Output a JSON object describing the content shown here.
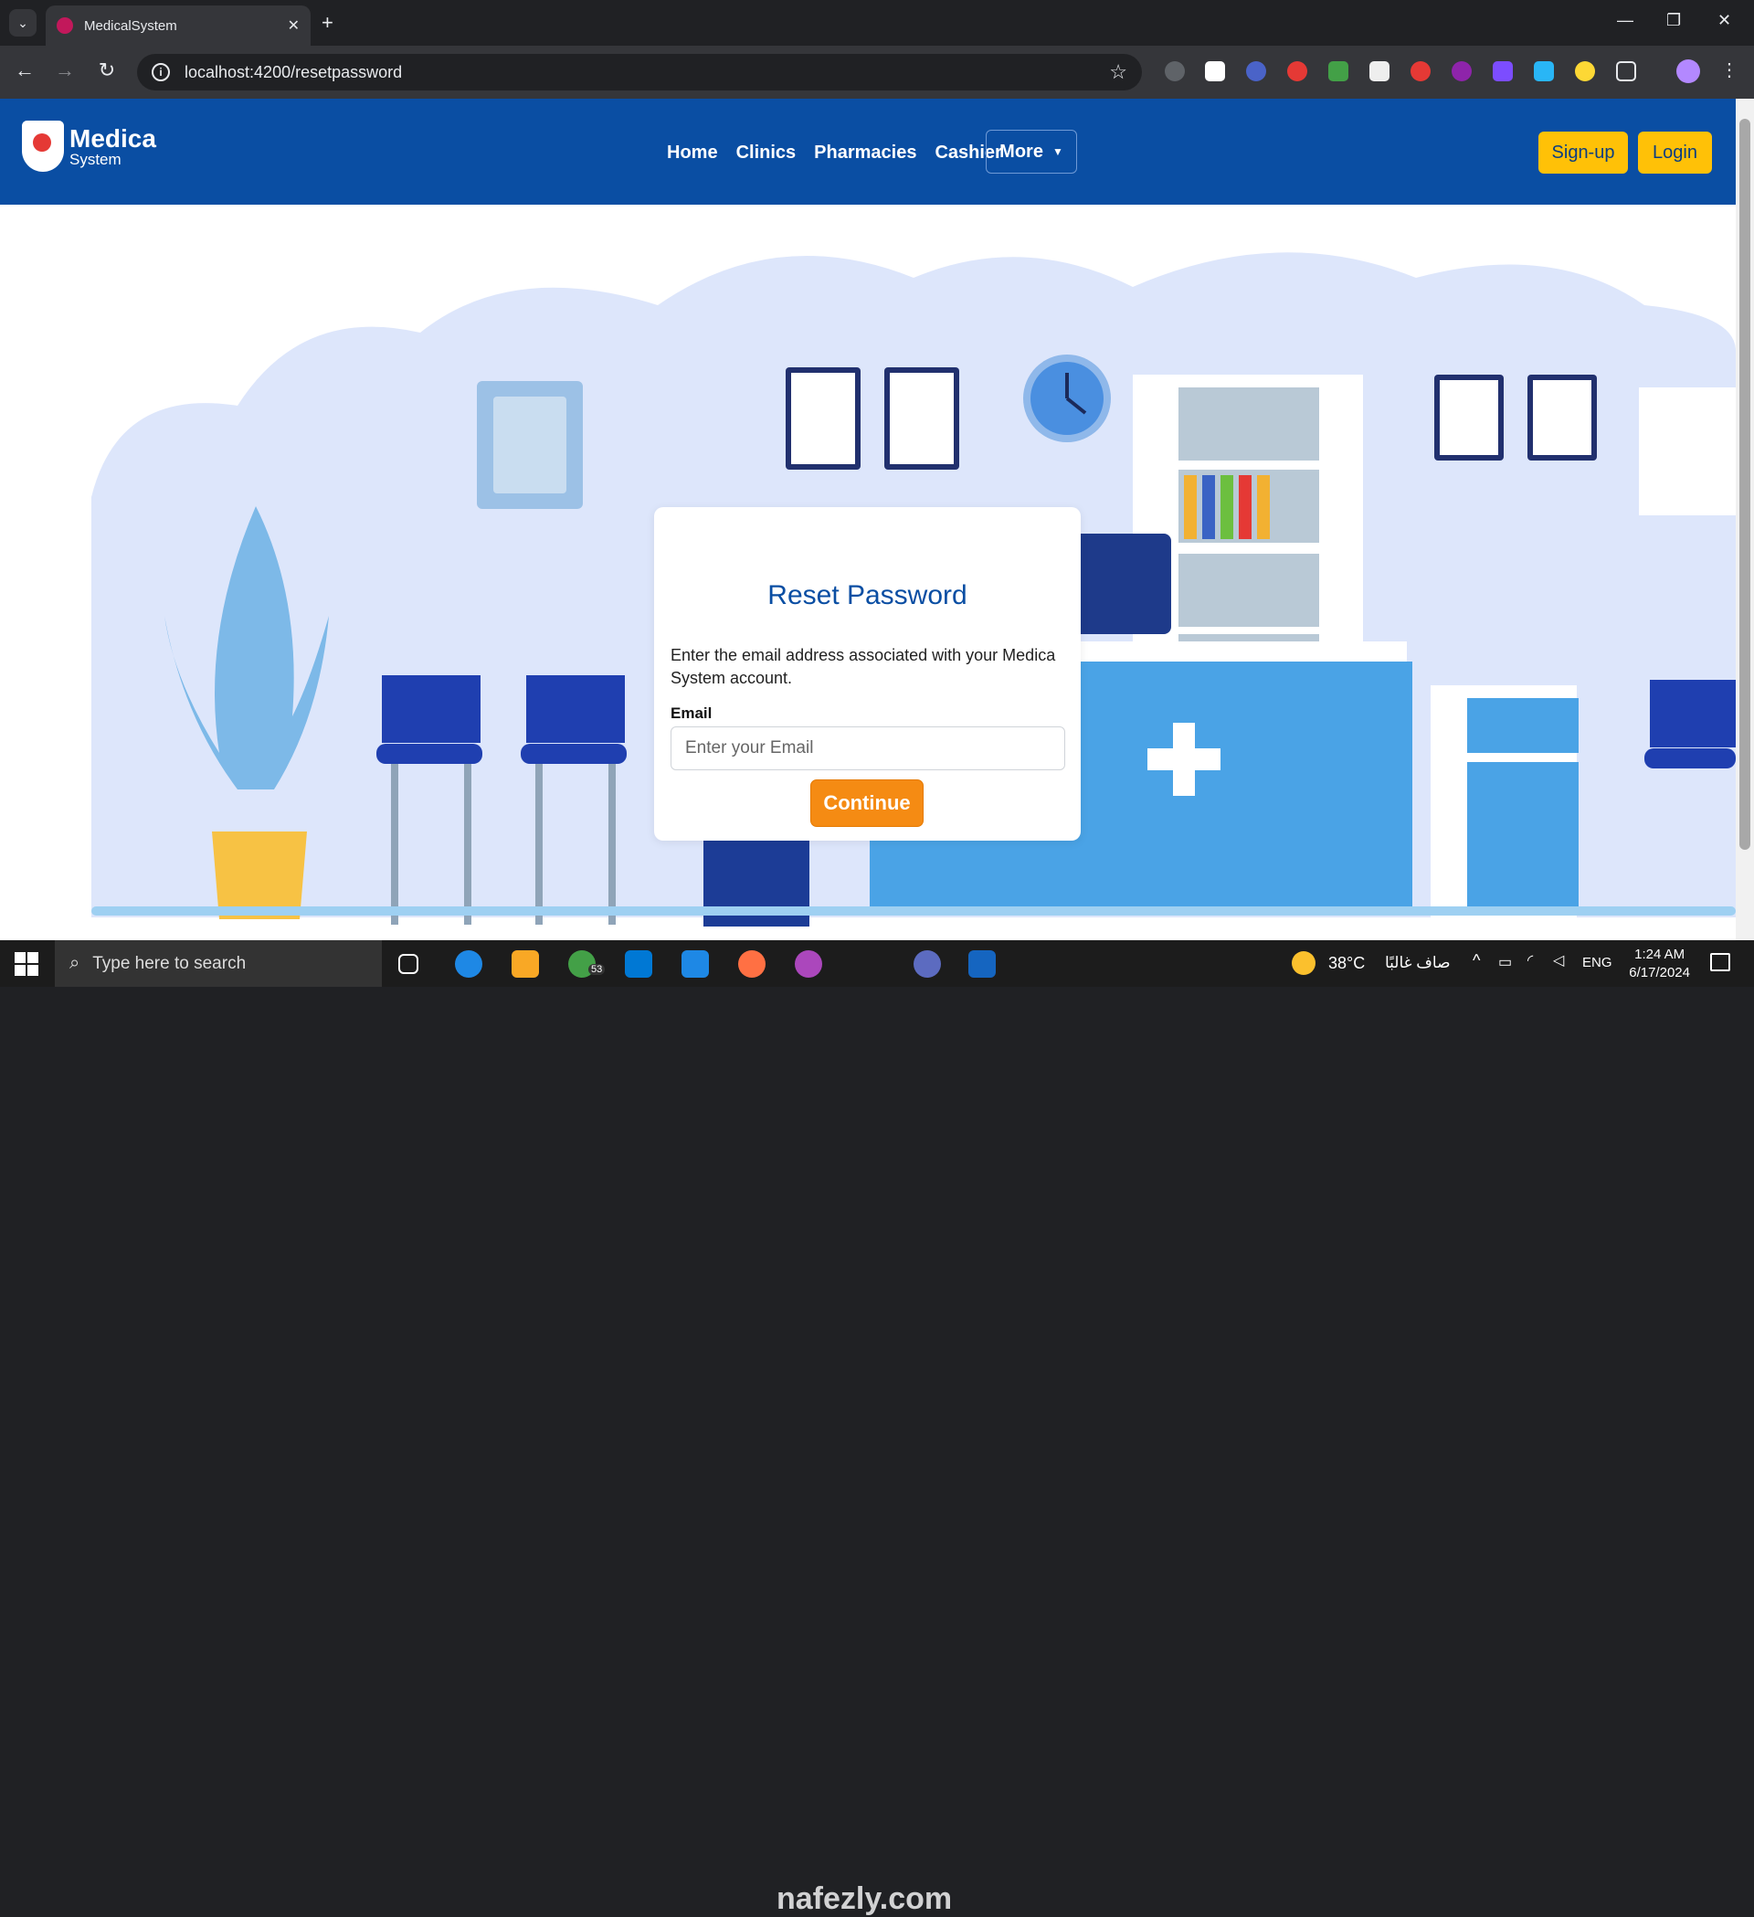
{
  "browser": {
    "tab_title": "MedicalSystem",
    "url": "localhost:4200/resetpassword"
  },
  "navbar": {
    "brand_line1": "Medica",
    "brand_line2": "System",
    "links": [
      "Home",
      "Clinics",
      "Pharmacies",
      "Cashier"
    ],
    "more_label": "More",
    "signup_label": "Sign-up",
    "login_label": "Login"
  },
  "reset": {
    "title": "Reset Password",
    "description": "Enter the email address associated with your Medica System account.",
    "email_label": "Email",
    "email_placeholder": "Enter your Email",
    "email_value": "",
    "continue_label": "Continue"
  },
  "taskbar": {
    "search_placeholder": "Type here to search",
    "whatsapp_badge": "53",
    "weather_temp": "38°C",
    "weather_text": "صاف غالبًا",
    "language": "ENG",
    "time": "1:24 AM",
    "date": "6/17/2024"
  },
  "watermark": "nafezly.com",
  "colors": {
    "navbar": "#0a4ea3",
    "accent_yellow": "#ffc107",
    "continue_orange": "#f58b13",
    "scene_bg": "#dde6fb"
  }
}
